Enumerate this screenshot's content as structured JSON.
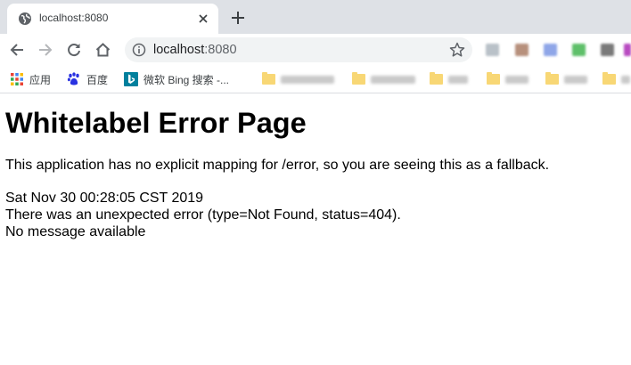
{
  "tab": {
    "title": "localhost:8080",
    "favicon": "globe-icon",
    "close_icon": "close-icon",
    "new_tab_icon": "plus-icon"
  },
  "toolbar": {
    "back_icon": "back-arrow-icon",
    "forward_icon": "forward-arrow-icon",
    "reload_icon": "reload-icon",
    "home_icon": "home-icon",
    "info_icon": "info-icon",
    "bookmark_icon": "star-icon",
    "url_host": "localhost",
    "url_port": ":8080"
  },
  "bookmarks": {
    "apps_label": "应用",
    "baidu_label": "百度",
    "bing_label": "微软 Bing 搜索 -..."
  },
  "page": {
    "title": "Whitelabel Error Page",
    "message": "This application has no explicit mapping for /error, so you are seeing this as a fallback.",
    "timestamp": "Sat Nov 30 00:28:05 CST 2019",
    "error_line": "There was an unexpected error (type=Not Found, status=404).",
    "detail_line": "No message available"
  },
  "colors": {
    "tabstrip_bg": "#dee1e6",
    "omnibox_bg": "#f1f3f4",
    "folder": "#f8d775",
    "baidu_blue": "#2932e1",
    "bing_teal": "#00809d"
  }
}
